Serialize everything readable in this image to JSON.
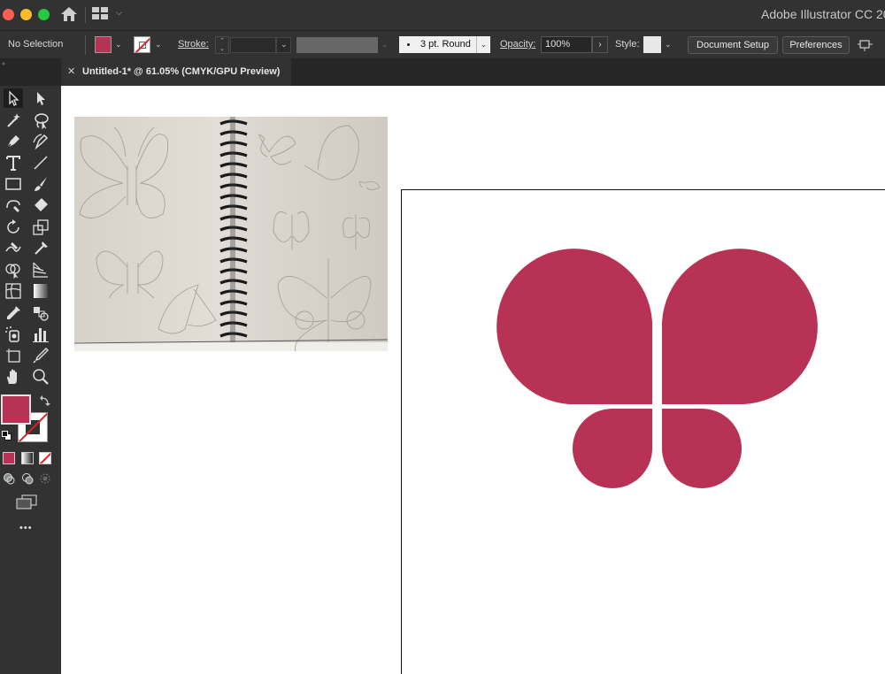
{
  "window": {
    "app_title": "Adobe Illustrator CC 20",
    "icons": [
      "home-icon",
      "workspace-switcher-icon"
    ]
  },
  "control_bar": {
    "selection_label": "No Selection",
    "fill_color": "#b73254",
    "stroke_label": "Stroke:",
    "brush_value": "3 pt. Round",
    "opacity_label": "Opacity:",
    "opacity_value": "100%",
    "style_label": "Style:",
    "document_setup": "Document Setup",
    "preferences": "Preferences"
  },
  "tab": {
    "close_glyph": "✕",
    "title": "Untitled-1* @ 61.05% (CMYK/GPU Preview)"
  },
  "toolbar": {
    "more_glyph": "•••",
    "tools": [
      "selection-tool",
      "direct-selection-tool",
      "magic-wand-tool",
      "lasso-tool",
      "pen-tool",
      "curvature-tool",
      "type-tool",
      "line-segment-tool",
      "rectangle-tool",
      "paintbrush-tool",
      "shaper-tool",
      "eraser-tool",
      "rotate-tool",
      "scale-tool",
      "warp-tool",
      "puppet-warp-tool",
      "shape-builder-tool",
      "perspective-grid-tool",
      "mesh-tool",
      "gradient-tool",
      "eyedropper-tool",
      "blend-tool",
      "symbol-sprayer-tool",
      "column-graph-tool",
      "artboard-tool",
      "slice-tool",
      "hand-tool",
      "zoom-tool"
    ]
  },
  "colors": {
    "butterfly": "#b73254",
    "ui_dark": "#323232",
    "ui_darker": "#262626"
  }
}
